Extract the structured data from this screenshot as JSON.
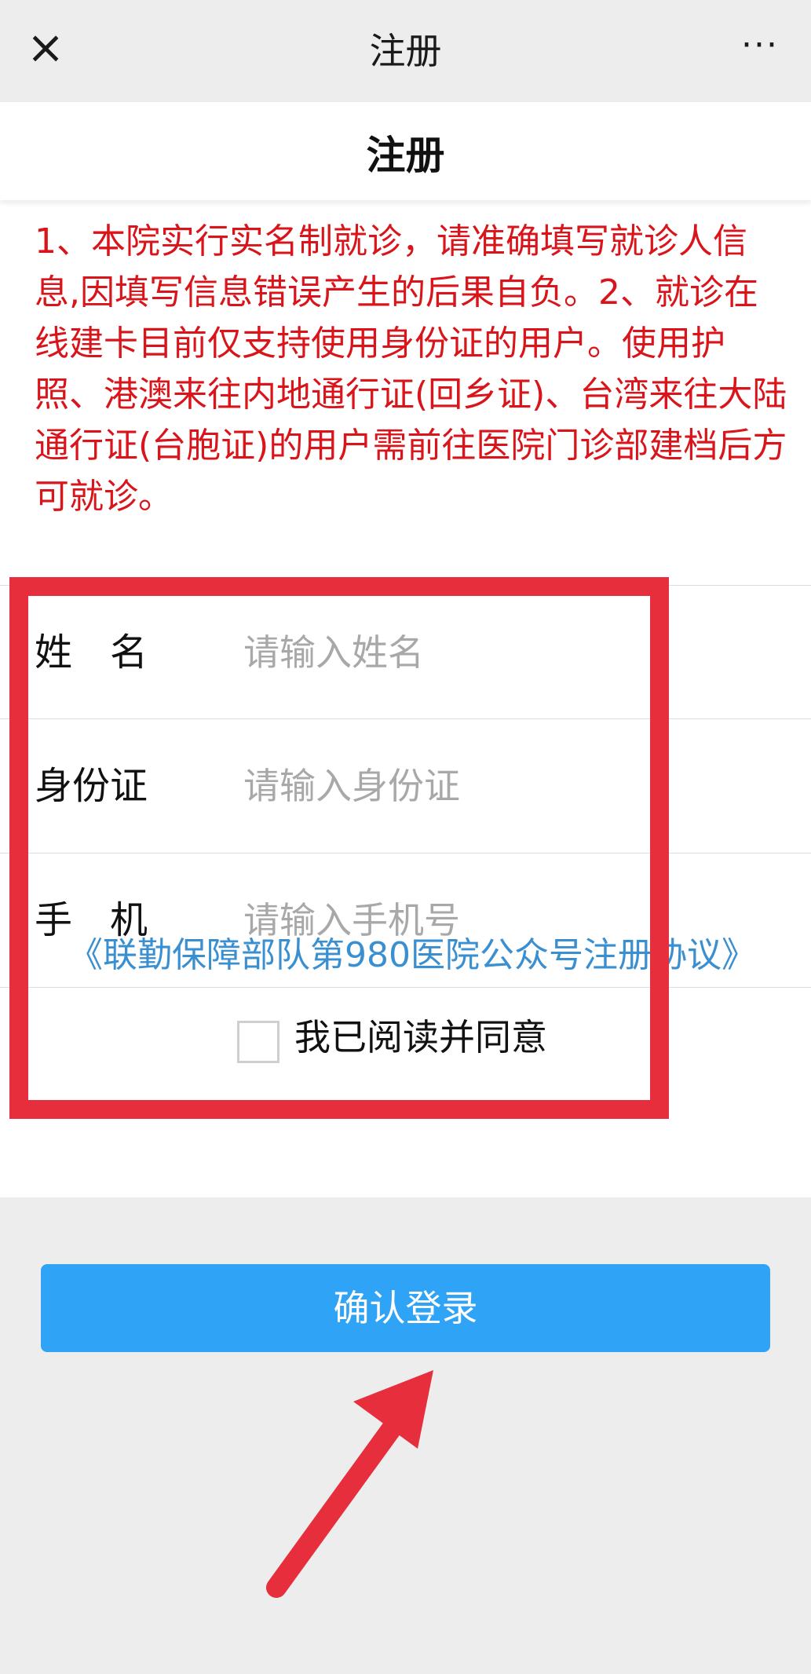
{
  "topbar": {
    "close_icon": "×",
    "title": "注册",
    "more_icon": "···"
  },
  "header": {
    "title": "注册"
  },
  "notice": {
    "text": "1、本院实行实名制就诊，请准确填写就诊人信息,因填写信息错误产生的后果自负。2、就诊在线建卡目前仅支持使用身份证的用户。使用护照、港澳来往内地通行证(回乡证)、台湾来往大陆通行证(台胞证)的用户需前往医院门诊部建档后方可就诊。",
    "color": "#d9141a"
  },
  "form": {
    "name_label": "姓　名",
    "name_placeholder": "请输入姓名",
    "id_label": "身份证",
    "id_placeholder": "请输入身份证",
    "phone_label": "手　机",
    "phone_placeholder": "请输入手机号",
    "agree_text": "我已阅读并同意"
  },
  "protocol_link": "《联勤保障部队第980医院公众号注册协议》",
  "confirm_button": "确认登录",
  "colors": {
    "accent": "#2fa3f5",
    "annotation": "#e62e3d",
    "link": "#3a8fd0"
  }
}
